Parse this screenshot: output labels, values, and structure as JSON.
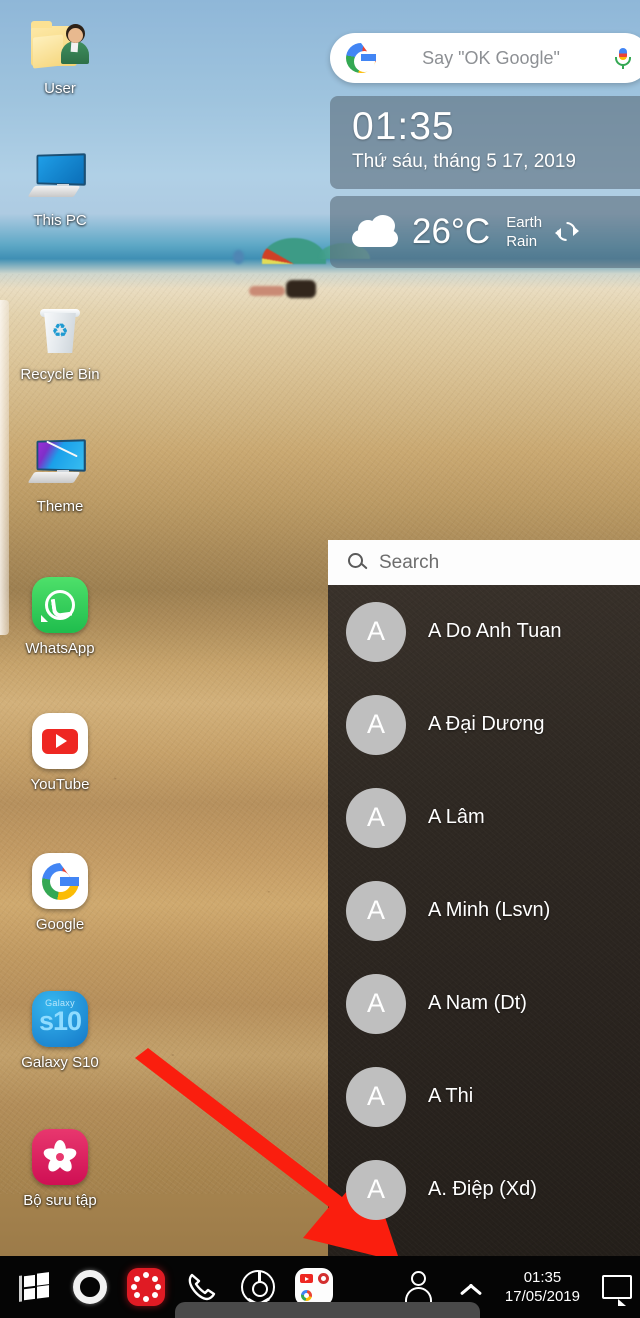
{
  "desktop": {
    "icons": [
      {
        "label": "User",
        "icon": "user-folder-icon"
      },
      {
        "label": "This PC",
        "icon": "computer-icon"
      },
      {
        "label": "Recycle Bin",
        "icon": "recycle-bin-icon"
      },
      {
        "label": "Theme",
        "icon": "theme-monitor-icon"
      },
      {
        "label": "WhatsApp",
        "icon": "whatsapp-icon"
      },
      {
        "label": "YouTube",
        "icon": "youtube-icon"
      },
      {
        "label": "Google",
        "icon": "google-icon"
      },
      {
        "label": "Galaxy S10",
        "icon": "galaxy-s10-icon"
      },
      {
        "label": "Bộ sưu tập",
        "icon": "gallery-flower-icon"
      }
    ]
  },
  "google_search": {
    "placeholder": "Say \"OK Google\"",
    "logo_icon": "google-g-icon",
    "mic_icon": "microphone-icon"
  },
  "clock_widget": {
    "time": "01:35",
    "date": "Thứ sáu, tháng 5 17, 2019"
  },
  "weather_widget": {
    "condition_icon": "cloud-icon",
    "temperature": "26°C",
    "location_line1": "Earth",
    "location_line2": "Rain",
    "refresh_icon": "refresh-icon"
  },
  "contacts_panel": {
    "search": {
      "placeholder": "Search",
      "icon": "search-icon"
    },
    "items": [
      {
        "avatar": "A",
        "name": "A Do Anh Tuan"
      },
      {
        "avatar": "A",
        "name": "A Đại Dương"
      },
      {
        "avatar": "A",
        "name": "A Lâm"
      },
      {
        "avatar": "A",
        "name": "A Minh (Lsvn)"
      },
      {
        "avatar": "A",
        "name": "A Nam (Dt)"
      },
      {
        "avatar": "A",
        "name": "A Thi"
      },
      {
        "avatar": "A",
        "name": "A. Điệp (Xd)"
      }
    ]
  },
  "taskbar": {
    "start_icon": "windows-start-icon",
    "apps": [
      {
        "name": "cortana-circle-icon"
      },
      {
        "name": "red-dots-app-icon"
      },
      {
        "name": "phone-icon"
      },
      {
        "name": "chrome-icon"
      },
      {
        "name": "app-folder-icon"
      }
    ],
    "tray": {
      "people_icon": "people-icon",
      "show_hidden_icon": "chevron-up-icon",
      "time": "01:35",
      "date": "17/05/2019",
      "action_center_icon": "action-center-icon"
    }
  },
  "annotation": {
    "arrow_color": "#fa1e0e",
    "arrow_icon": "red-arrow-icon"
  },
  "colors": {
    "taskbar_bg": "#050505",
    "panel_bg": "#2f2923",
    "widget_bg": "#5c6e7c",
    "accent_red": "#fa1e0e"
  }
}
